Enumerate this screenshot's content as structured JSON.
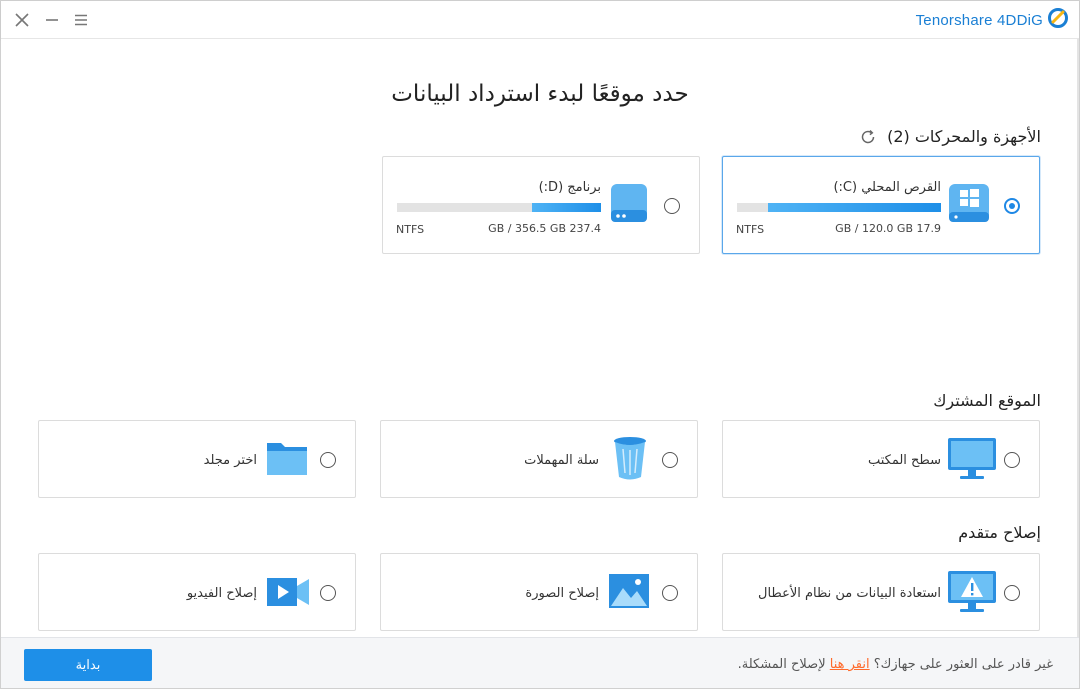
{
  "window": {
    "brand": "Tenorshare 4DDiG",
    "controls": [
      "close-icon",
      "minimize-icon",
      "menu-icon"
    ]
  },
  "page": {
    "title": "حدد موقعًا لبدء استرداد البيانات"
  },
  "sections": {
    "devices_title": "الأجهزة والمحركات",
    "devices_count": "(2)",
    "common_title": "الموقع المشترك",
    "repair_title": "إصلاح متقدم"
  },
  "drives": [
    {
      "name": "القرص المحلي (C:)",
      "size": "17.9 GB / 120.0 GB",
      "filesystem": "NTFS",
      "used_fraction": 0.85,
      "selected": true,
      "icon": "windows-drive-icon"
    },
    {
      "name": "برنامج (D:)",
      "size": "237.4 GB / 356.5 GB",
      "filesystem": "NTFS",
      "used_fraction": 0.34,
      "selected": false,
      "icon": "drive-icon"
    }
  ],
  "common_locations": [
    {
      "label": "سطح المكتب",
      "icon": "desktop-icon"
    },
    {
      "label": "سلة المهملات",
      "icon": "recycle-bin-icon"
    },
    {
      "label": "اختر مجلد",
      "icon": "folder-icon"
    }
  ],
  "advanced_repair": [
    {
      "label": "استعادة البيانات من نظام الأعطال",
      "icon": "crashed-system-icon"
    },
    {
      "label": "إصلاح الصورة",
      "icon": "photo-icon"
    },
    {
      "label": "إصلاح الفيديو",
      "icon": "video-icon"
    }
  ],
  "footer": {
    "start_button": "بداية",
    "help_prefix": "غير قادر على العثور على جهازك؟",
    "help_link": "انقر هنا",
    "help_suffix": "لإصلاح المشكلة."
  },
  "colors": {
    "accent": "#1e8fe8",
    "link": "#ff6a2b",
    "brand": "#1a7fd4"
  }
}
